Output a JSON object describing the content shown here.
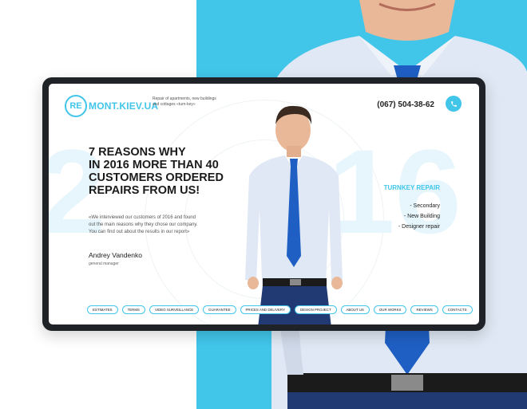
{
  "logo": {
    "badge": "RE",
    "text": "MONT.KIEV.UA"
  },
  "tagline": "Repair of apartments, new buildings and cottages «turn-key»",
  "phone": "(067) 504-38-62",
  "year": {
    "left": "2",
    "right": "16"
  },
  "headline": "7 REASONS WHY\nIN 2016 MORE THAN 40\nCUSTOMERS ORDERED\nREPAIRS FROM US!",
  "quote": "«We interviewed our customers of 2016 and found out the main reasons why they chose our company. You can find out about the results in our report»",
  "author": {
    "name": "Andrey Vandenko",
    "role": "general manager"
  },
  "turnkey": {
    "title": "TURNKEY REPAIR",
    "items": [
      "- Secondary",
      "-  New Building",
      "- Designer repair"
    ]
  },
  "nav": [
    "ESTIMATES",
    "TERMS",
    "VIDEO SURVEILLANCE",
    "GUARANTEE",
    "PRICES AND DELIVERY",
    "DESIGN PROJECT",
    "ABOUT US",
    "OUR WORKS",
    "REVIEWS",
    "CONTACTS"
  ],
  "colors": {
    "accent": "#41c6ea",
    "frame": "#1f2226",
    "shirt": "#dfe8f4",
    "tie": "#1f5fc4"
  },
  "icons": {
    "phone_button": "phone-icon"
  }
}
